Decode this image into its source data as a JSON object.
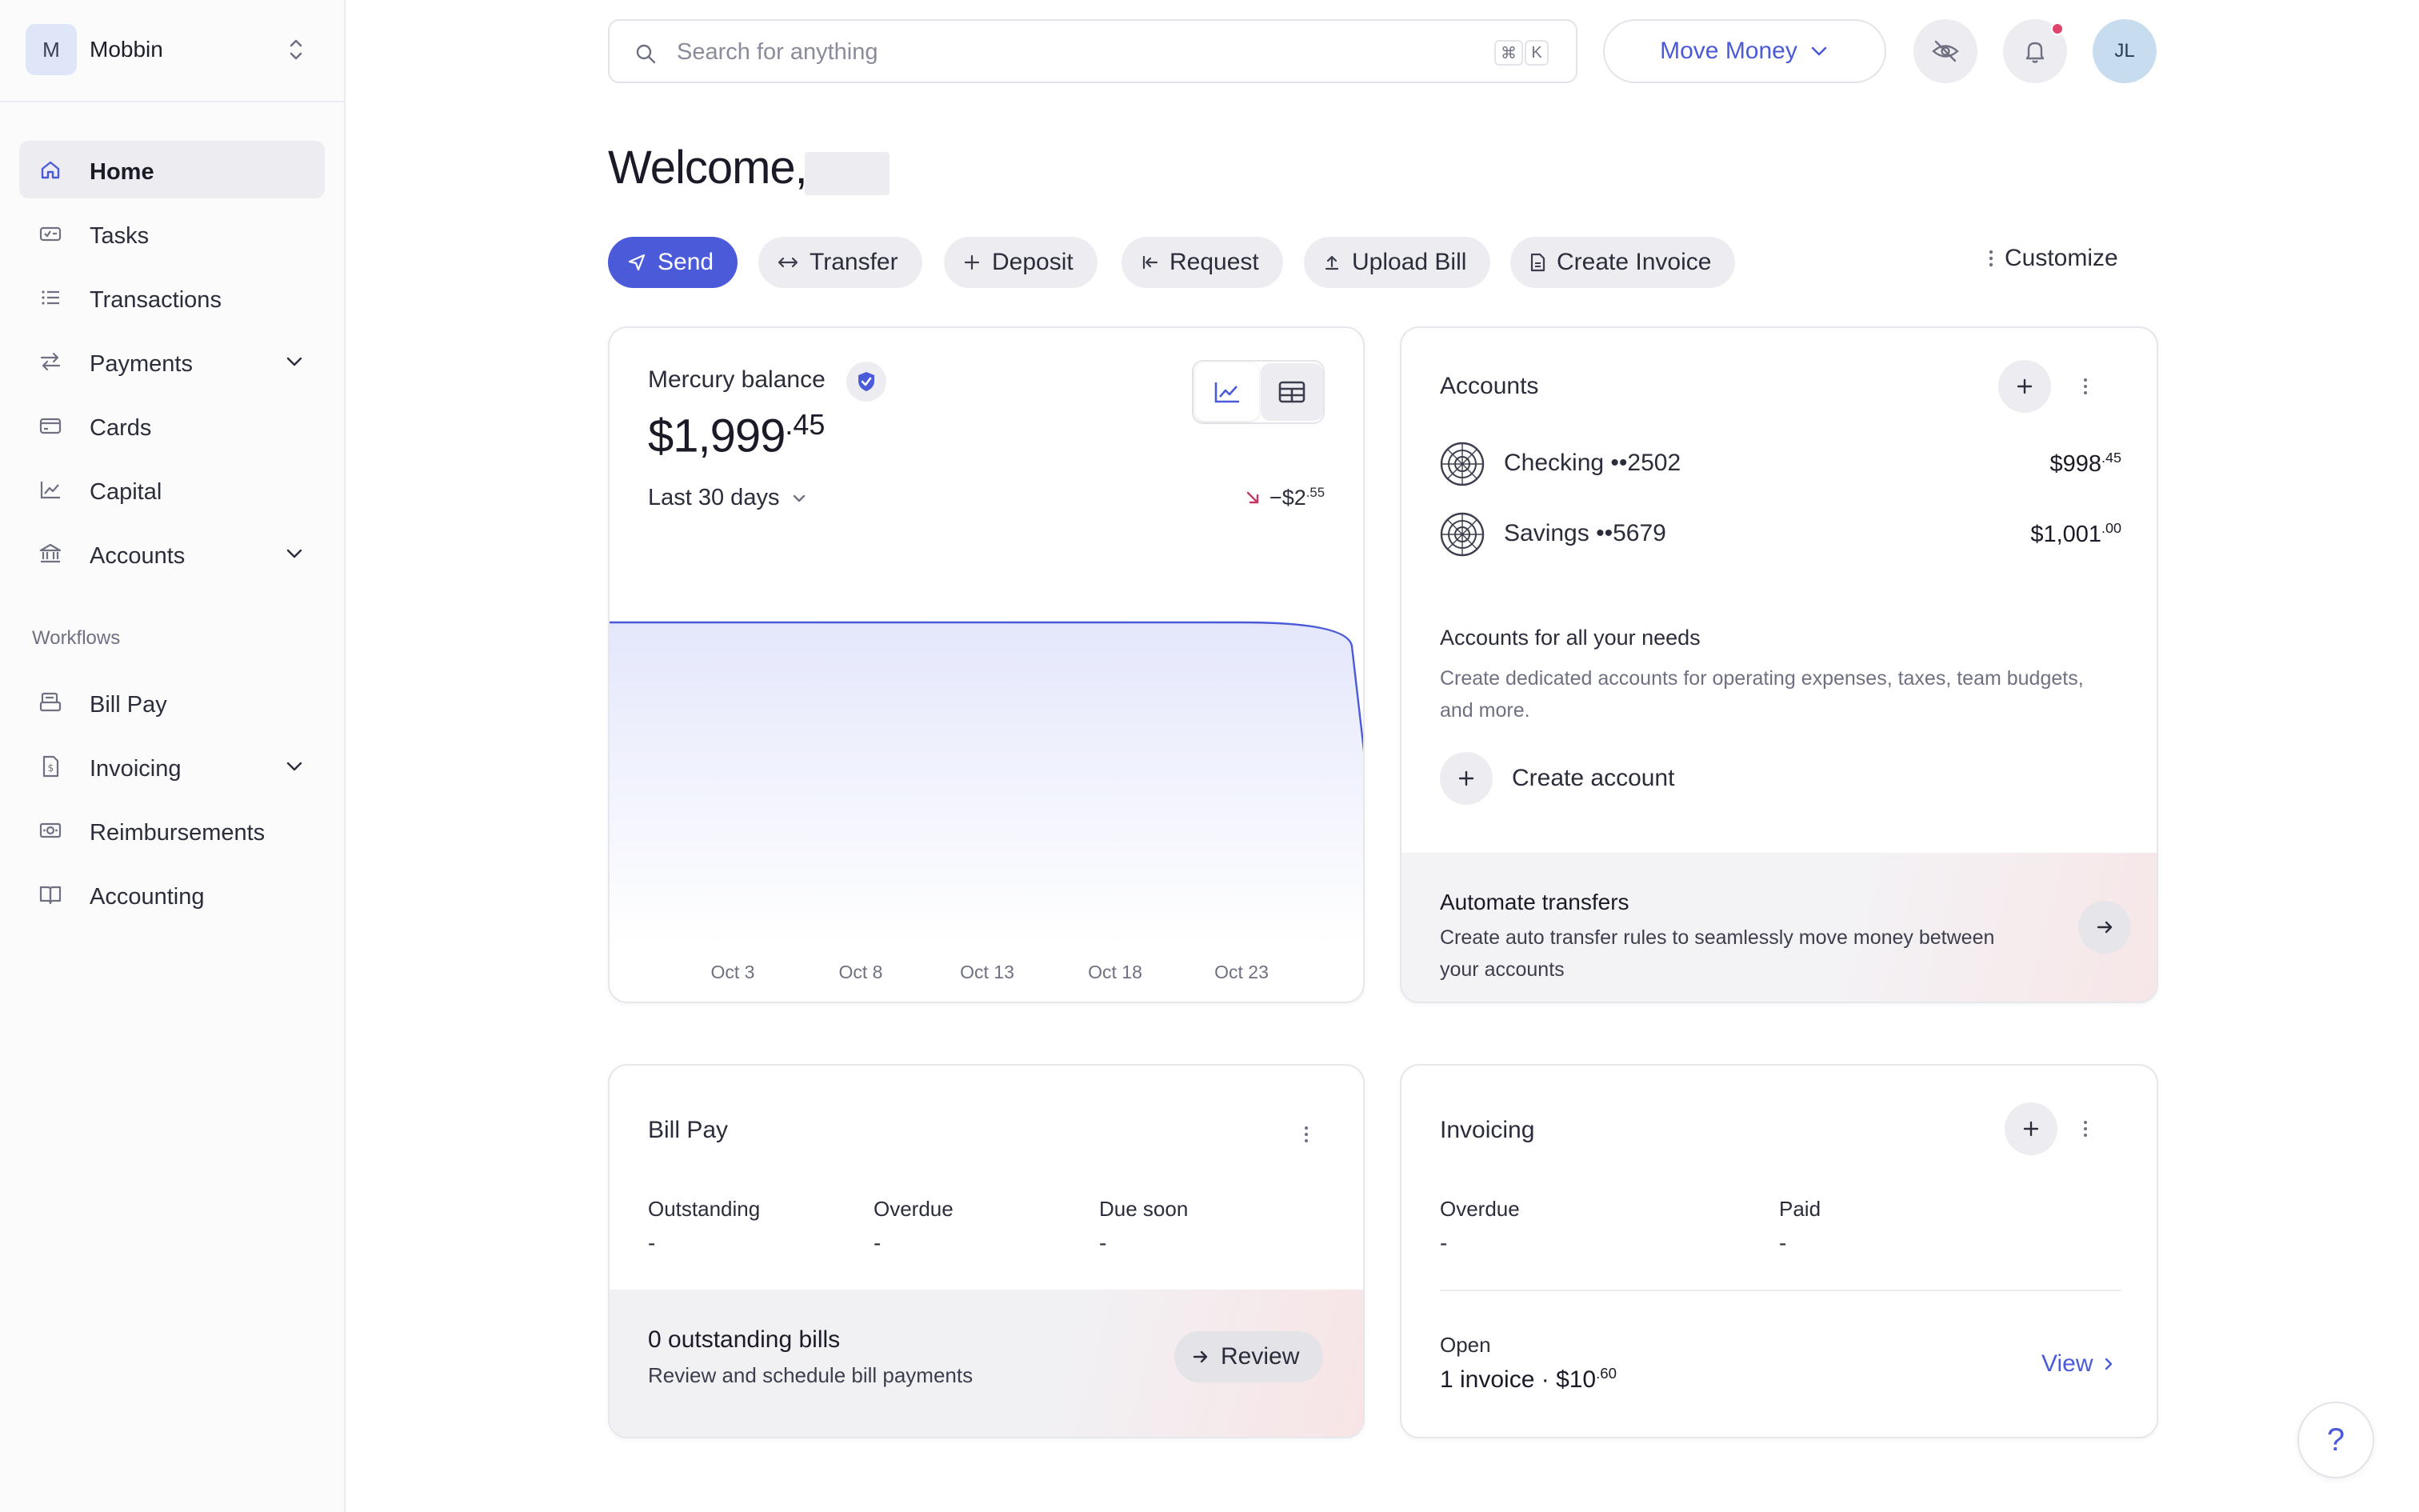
{
  "org": {
    "initial": "M",
    "name": "Mobbin"
  },
  "nav": {
    "items": [
      {
        "label": "Home",
        "icon": "home-icon"
      },
      {
        "label": "Tasks",
        "icon": "tasks-icon"
      },
      {
        "label": "Transactions",
        "icon": "list-icon"
      },
      {
        "label": "Payments",
        "icon": "arrows-swap-icon"
      },
      {
        "label": "Cards",
        "icon": "card-icon"
      },
      {
        "label": "Capital",
        "icon": "line-chart-icon"
      },
      {
        "label": "Accounts",
        "icon": "bank-icon"
      }
    ],
    "section_label": "Workflows",
    "workflows": [
      {
        "label": "Bill Pay",
        "icon": "bill-icon"
      },
      {
        "label": "Invoicing",
        "icon": "invoice-icon"
      },
      {
        "label": "Reimbursements",
        "icon": "cash-icon"
      },
      {
        "label": "Accounting",
        "icon": "book-icon"
      }
    ]
  },
  "search": {
    "placeholder": "Search for anything",
    "shortcut_cmd": "⌘",
    "shortcut_key": "K"
  },
  "topbar": {
    "move_money": "Move Money",
    "user_initials": "JL"
  },
  "welcome": "Welcome,",
  "actions": {
    "send": "Send",
    "transfer": "Transfer",
    "deposit": "Deposit",
    "request": "Request",
    "upload_bill": "Upload Bill",
    "create_invoice": "Create Invoice",
    "customize": "Customize"
  },
  "balance": {
    "title": "Mercury balance",
    "amount_main": "$1,999",
    "amount_cents": ".45",
    "period": "Last 30 days",
    "change_main": "−$2",
    "change_cents": ".55"
  },
  "chart_data": {
    "type": "area",
    "title": "",
    "x_tick_labels": [
      "Oct 3",
      "Oct 8",
      "Oct 13",
      "Oct 18",
      "Oct 23"
    ],
    "x": [
      "Sep 29",
      "Oct 3",
      "Oct 8",
      "Oct 13",
      "Oct 18",
      "Oct 23",
      "Oct 26",
      "Oct 28"
    ],
    "values": [
      2002.0,
      2002.0,
      2002.0,
      2002.0,
      2002.0,
      2002.0,
      2002.0,
      1999.45
    ],
    "accent_color": "#4a5ad8",
    "fill_color": "#e4e7fb"
  },
  "accounts": {
    "title": "Accounts",
    "list": [
      {
        "name": "Checking",
        "mask": "••2502",
        "main": "$998",
        "cents": ".45"
      },
      {
        "name": "Savings",
        "mask": "••5679",
        "main": "$1,001",
        "cents": ".00"
      }
    ],
    "promo_title": "Accounts for all your needs",
    "promo_desc": "Create dedicated accounts for operating expenses, taxes, team budgets, and more.",
    "create_label": "Create account",
    "automate_title": "Automate transfers",
    "automate_desc": "Create auto transfer rules to seamlessly move money between your accounts"
  },
  "billpay": {
    "title": "Bill Pay",
    "outstanding_label": "Outstanding",
    "outstanding_value": "-",
    "overdue_label": "Overdue",
    "overdue_value": "-",
    "due_soon_label": "Due soon",
    "due_soon_value": "-",
    "footer_title": "0 outstanding bills",
    "footer_desc": "Review and schedule bill payments",
    "review_label": "Review"
  },
  "invoicing": {
    "title": "Invoicing",
    "overdue_label": "Overdue",
    "overdue_value": "-",
    "paid_label": "Paid",
    "paid_value": "-",
    "open_label": "Open",
    "open_main": "1 invoice · $10",
    "open_cents": ".60",
    "view_label": "View"
  },
  "help": {
    "label": "?"
  },
  "colors": {
    "accent": "#4a5ad8",
    "notification": "#e0446b",
    "negative": "#c23a62"
  }
}
